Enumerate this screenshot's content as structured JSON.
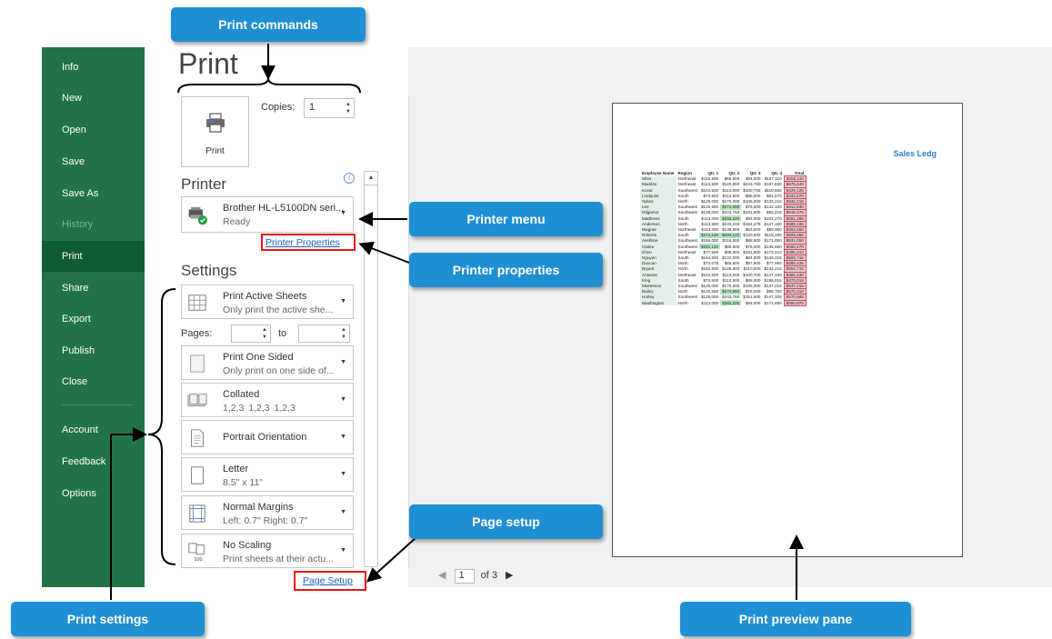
{
  "callouts": {
    "print_commands": "Print commands",
    "printer_menu": "Printer menu",
    "printer_properties": "Printer properties",
    "page_setup": "Page setup",
    "print_settings": "Print settings",
    "print_preview_pane": "Print preview pane"
  },
  "sidebar": {
    "items": [
      {
        "label": "Info"
      },
      {
        "label": "New"
      },
      {
        "label": "Open"
      },
      {
        "label": "Save"
      },
      {
        "label": "Save As"
      },
      {
        "label": "History"
      },
      {
        "label": "Print"
      },
      {
        "label": "Share"
      },
      {
        "label": "Export"
      },
      {
        "label": "Publish"
      },
      {
        "label": "Close"
      },
      {
        "label": "Account"
      },
      {
        "label": "Feedback"
      },
      {
        "label": "Options"
      }
    ],
    "active": "Print",
    "disabled": "History",
    "color": "#217346"
  },
  "page_title": "Print",
  "print_button_label": "Print",
  "copies": {
    "label": "Copies:",
    "value": "1"
  },
  "printer": {
    "heading": "Printer",
    "name": "Brother HL-L5100DN seri...",
    "status": "Ready",
    "properties_link": "Printer Properties"
  },
  "settings": {
    "heading": "Settings",
    "what": {
      "title": "Print Active Sheets",
      "sub": "Only print the active she..."
    },
    "pages_label": "Pages:",
    "to_label": "to",
    "sided": {
      "title": "Print One Sided",
      "sub": "Only print on one side of..."
    },
    "collation": {
      "title": "Collated",
      "sub": "1,2,3   1,2,3   1,2,3"
    },
    "orientation": {
      "title": "Portrait Orientation"
    },
    "paper": {
      "title": "Letter",
      "sub": "8.5\" x 11\""
    },
    "margins": {
      "title": "Normal Margins",
      "sub": "Left:  0.7\"    Right:  0.7\""
    },
    "scaling": {
      "title": "No Scaling",
      "sub": "Print sheets at their actu..."
    },
    "page_setup_link": "Page Setup"
  },
  "preview": {
    "sheet_title": "Sales Ledg",
    "headers": [
      "Employee Name",
      "Region",
      "Qtr. 1",
      "Qtr. 2",
      "Qtr. 3",
      "Qtr. 4",
      "Total"
    ],
    "rows": [
      [
        "Silva",
        "Northeast",
        "$115,500",
        "$65,500",
        "$84,000",
        "$187,110",
        "$452,110"
      ],
      [
        "Maddox",
        "Northeast",
        "$113,500",
        "$120,550",
        "$243,760",
        "$197,830",
        "$675,640"
      ],
      [
        "Koval",
        "Southwest",
        "$104,500",
        "$113,000",
        "$100,700",
        "$110,925",
        "$429,125"
      ],
      [
        "Lindquist",
        "South",
        "$73,500",
        "$113,500",
        "$88,000",
        "$61,670",
        "$342,670"
      ],
      [
        "Sykes",
        "North",
        "$125,000",
        "$170,000",
        "$105,000",
        "$132,215",
        "$532,215"
      ],
      [
        "Lee",
        "Southwest",
        "$120,550",
        "$274,060",
        "$76,000",
        "$142,320",
        "$612,930"
      ],
      [
        "Gilgamot",
        "Southwest",
        "$128,000",
        "$243,760",
        "$151,500",
        "$92,215",
        "$615,475"
      ],
      [
        "Matthews",
        "South",
        "$113,000",
        "$282,225",
        "$84,000",
        "$102,270",
        "$581,495"
      ],
      [
        "Anderson",
        "North",
        "$113,500",
        "$243,240",
        "$184,275",
        "$147,150",
        "$688,165"
      ],
      [
        "Wagner",
        "Northeast",
        "$113,000",
        "$138,500",
        "$63,000",
        "$88,950",
        "$403,450"
      ],
      [
        "Roberts",
        "South",
        "$274,130",
        "$294,120",
        "$120,500",
        "$118,335",
        "$809,085"
      ],
      [
        "Avellone",
        "Southwest",
        "$156,000",
        "$115,500",
        "$88,500",
        "$171,050",
        "$531,050"
      ],
      [
        "Clarke",
        "Southwest",
        "$251,120",
        "$86,500",
        "$76,000",
        "$136,650",
        "$550,270"
      ],
      [
        "Chen",
        "Northeast",
        "$77,500",
        "$95,000",
        "$151,500",
        "$172,410",
        "$496,410"
      ],
      [
        "Nguyen",
        "South",
        "$154,500",
        "$122,000",
        "$84,000",
        "$149,215",
        "$509,715"
      ],
      [
        "Duncan",
        "North",
        "$74,075",
        "$65,500",
        "$87,900",
        "$77,950",
        "$285,425"
      ],
      [
        "Bryant",
        "North",
        "$182,500",
        "$128,000",
        "$110,000",
        "$134,215",
        "$554,715"
      ],
      [
        "Antonov",
        "Northeast",
        "$104,500",
        "$113,000",
        "$100,700",
        "$147,330",
        "$465,530"
      ],
      [
        "King",
        "South",
        "$73,500",
        "$113,500",
        "$88,000",
        "$195,015",
        "$470,015"
      ],
      [
        "Masterson",
        "Southwest",
        "$125,000",
        "$170,000",
        "$105,000",
        "$137,215",
        "$537,215"
      ],
      [
        "Bailey",
        "North",
        "$120,550",
        "$274,060",
        "$76,000",
        "$99,700",
        "$570,310"
      ],
      [
        "Hurley",
        "Southwest",
        "$128,000",
        "$243,760",
        "$151,500",
        "$147,325",
        "$670,585"
      ],
      [
        "Washington",
        "North",
        "$113,000",
        "$282,225",
        "$84,000",
        "$171,650",
        "$650,875"
      ]
    ],
    "page_current": "1",
    "page_of": "of 3"
  }
}
